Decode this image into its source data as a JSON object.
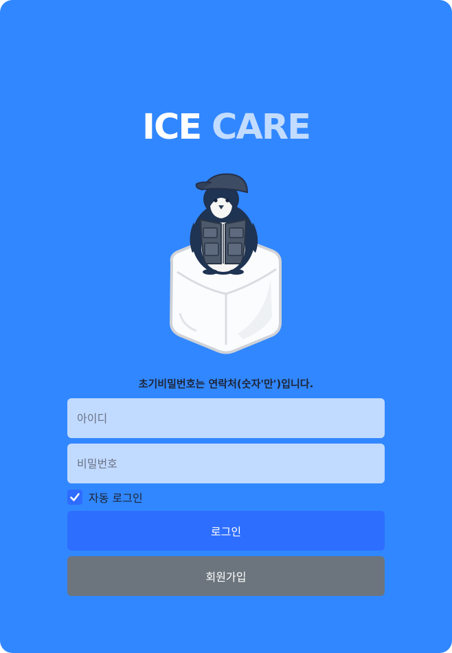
{
  "logo": {
    "word1": "ICE",
    "word2": "CARE"
  },
  "mascot": {
    "icon": "penguin-on-ice-cube-icon"
  },
  "notice": "초기비밀번호는 연락처(숫자'만')입니다.",
  "login_form": {
    "id_placeholder": "아이디",
    "id_value": "",
    "password_placeholder": "비밀번호",
    "password_value": "",
    "auto_login_label": "자동 로그인",
    "auto_login_checked": true,
    "login_button": "로그인",
    "signup_button": "회원가입"
  },
  "colors": {
    "background": "#3187ff",
    "logo_accent": "#c2dcff",
    "input_bg": "#c1daff",
    "primary_button": "#2e6eff",
    "secondary_button": "#6c757d"
  }
}
